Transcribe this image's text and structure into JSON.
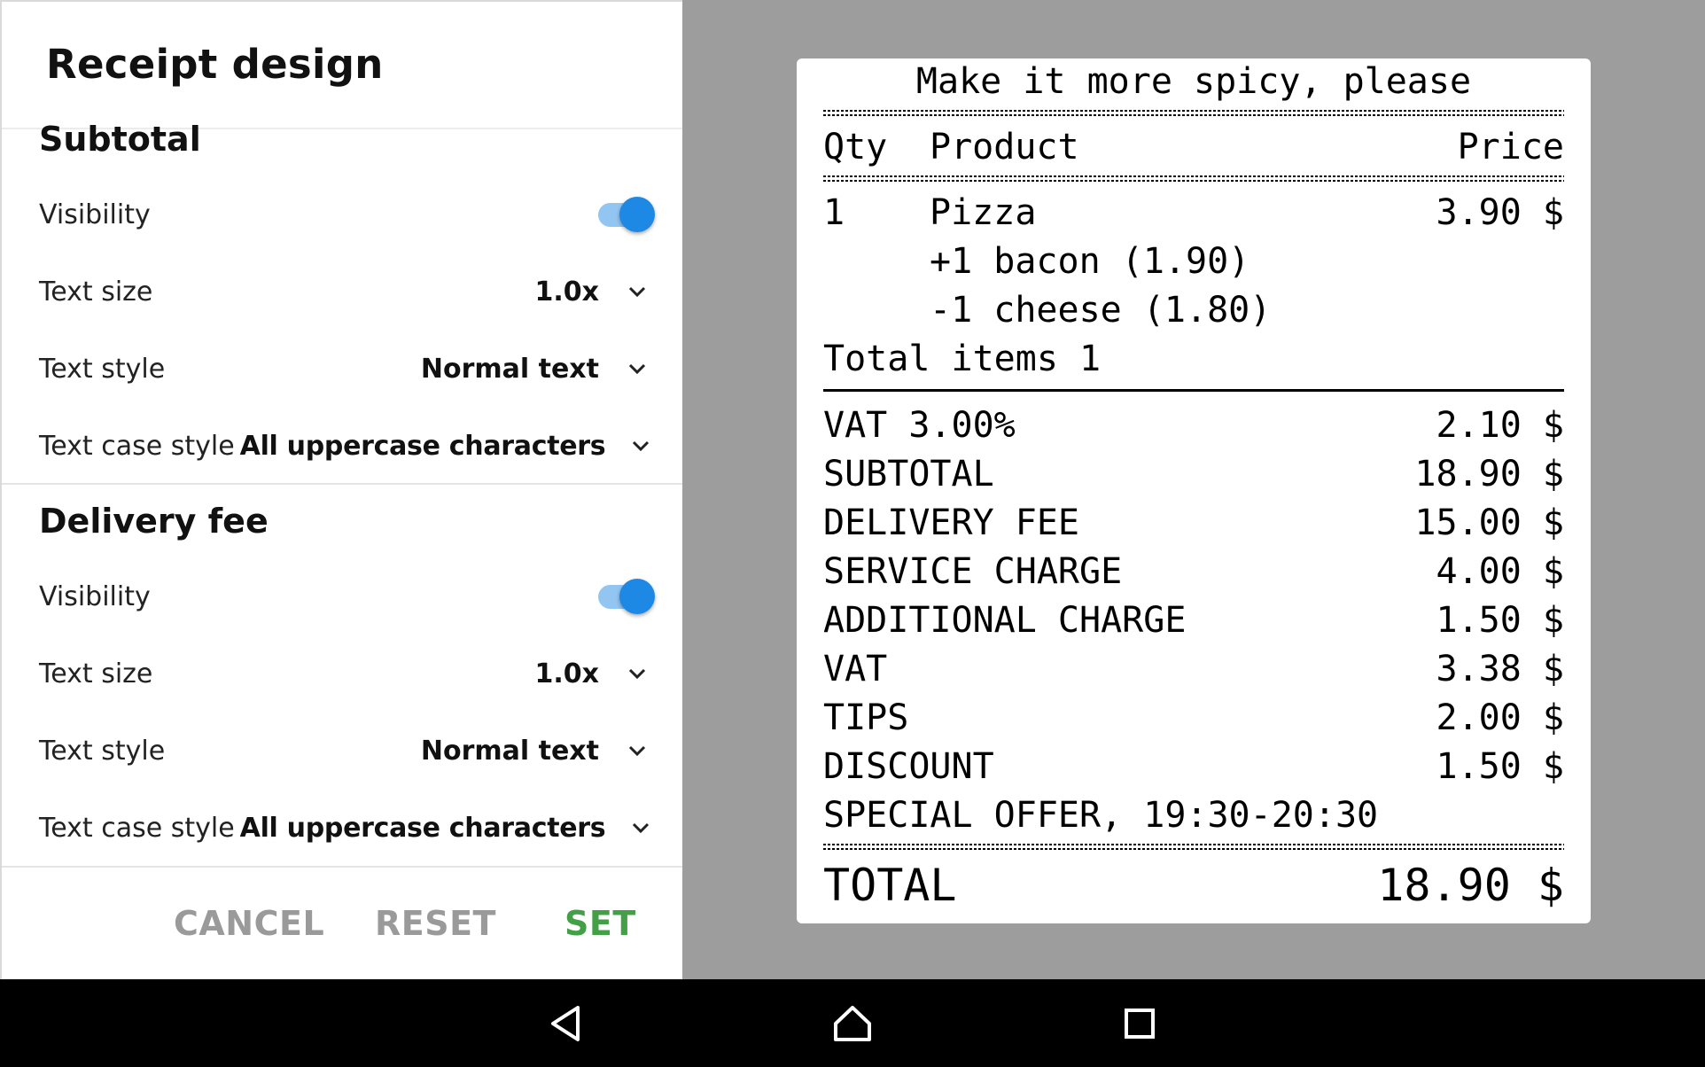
{
  "panel": {
    "title": "Receipt design",
    "sections": [
      {
        "header": "Subtotal",
        "visibility_label": "Visibility",
        "visibility_on": true,
        "text_size_label": "Text size",
        "text_size_value": "1.0x",
        "text_style_label": "Text style",
        "text_style_value": "Normal text",
        "text_case_label": "Text case style",
        "text_case_value": "All uppercase characters"
      },
      {
        "header": "Delivery fee",
        "visibility_label": "Visibility",
        "visibility_on": true,
        "text_size_label": "Text size",
        "text_size_value": "1.0x",
        "text_style_label": "Text style",
        "text_style_value": "Normal text",
        "text_case_label": "Text case style",
        "text_case_value": "All uppercase characters"
      }
    ],
    "buttons": {
      "cancel": "CANCEL",
      "reset": "RESET",
      "set": "SET"
    }
  },
  "receipt": {
    "note": "Make it more spicy, please",
    "headers": {
      "qty": "Qty",
      "product": "Product",
      "price": "Price"
    },
    "item": {
      "qty": "1",
      "name": "Pizza",
      "price": "3.90 $",
      "modifiers": [
        "+1 bacon (1.90)",
        "-1 cheese (1.80)"
      ]
    },
    "total_items": "Total items 1",
    "lines": [
      {
        "label": "VAT 3.00%",
        "amount": "2.10 $"
      },
      {
        "label": "SUBTOTAL",
        "amount": "18.90 $"
      },
      {
        "label": "DELIVERY FEE",
        "amount": "15.00 $"
      },
      {
        "label": "SERVICE CHARGE",
        "amount": "4.00 $"
      },
      {
        "label": "ADDITIONAL CHARGE",
        "amount": "1.50 $"
      },
      {
        "label": "VAT",
        "amount": "3.38 $"
      },
      {
        "label": "TIPS",
        "amount": "2.00 $"
      },
      {
        "label": "DISCOUNT",
        "amount": "1.50 $"
      }
    ],
    "special_offer": "SPECIAL OFFER, 19:30-20:30",
    "total_label": "TOTAL",
    "total_amount": "18.90 $"
  },
  "navbar": {
    "icons": [
      "back-icon",
      "home-icon",
      "recents-icon"
    ]
  },
  "colors": {
    "toggle_on": "#1e88e5",
    "set_button": "#43a047",
    "preview_bg": "#9d9d9d",
    "nav_bg": "#000000"
  }
}
